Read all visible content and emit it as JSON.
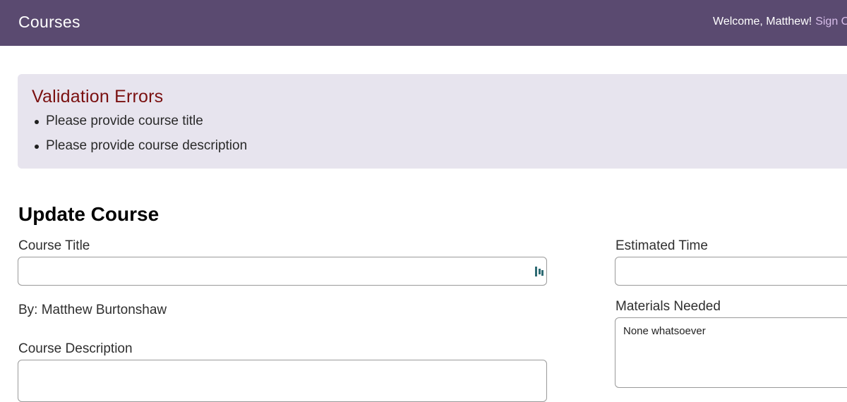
{
  "header": {
    "title": "Courses",
    "welcome": "Welcome, Matthew!",
    "sign_out": "Sign Out"
  },
  "validation": {
    "title": "Validation Errors",
    "errors": [
      "Please provide course title",
      "Please provide course description"
    ]
  },
  "form": {
    "heading": "Update Course",
    "course_title_label": "Course Title",
    "course_title_value": "",
    "author": "By: Matthew Burtonshaw",
    "description_label": "Course Description",
    "description_value": "",
    "estimated_time_label": "Estimated Time",
    "estimated_time_value": "",
    "materials_label": "Materials Needed",
    "materials_value": "None whatsoever"
  },
  "icons": {
    "input_helper": "password-manager-icon"
  },
  "colors": {
    "header_bg": "#5a4a70",
    "error_bg": "#e7e4ee",
    "error_title": "#7a1010",
    "sign_out": "#d7bde9"
  }
}
